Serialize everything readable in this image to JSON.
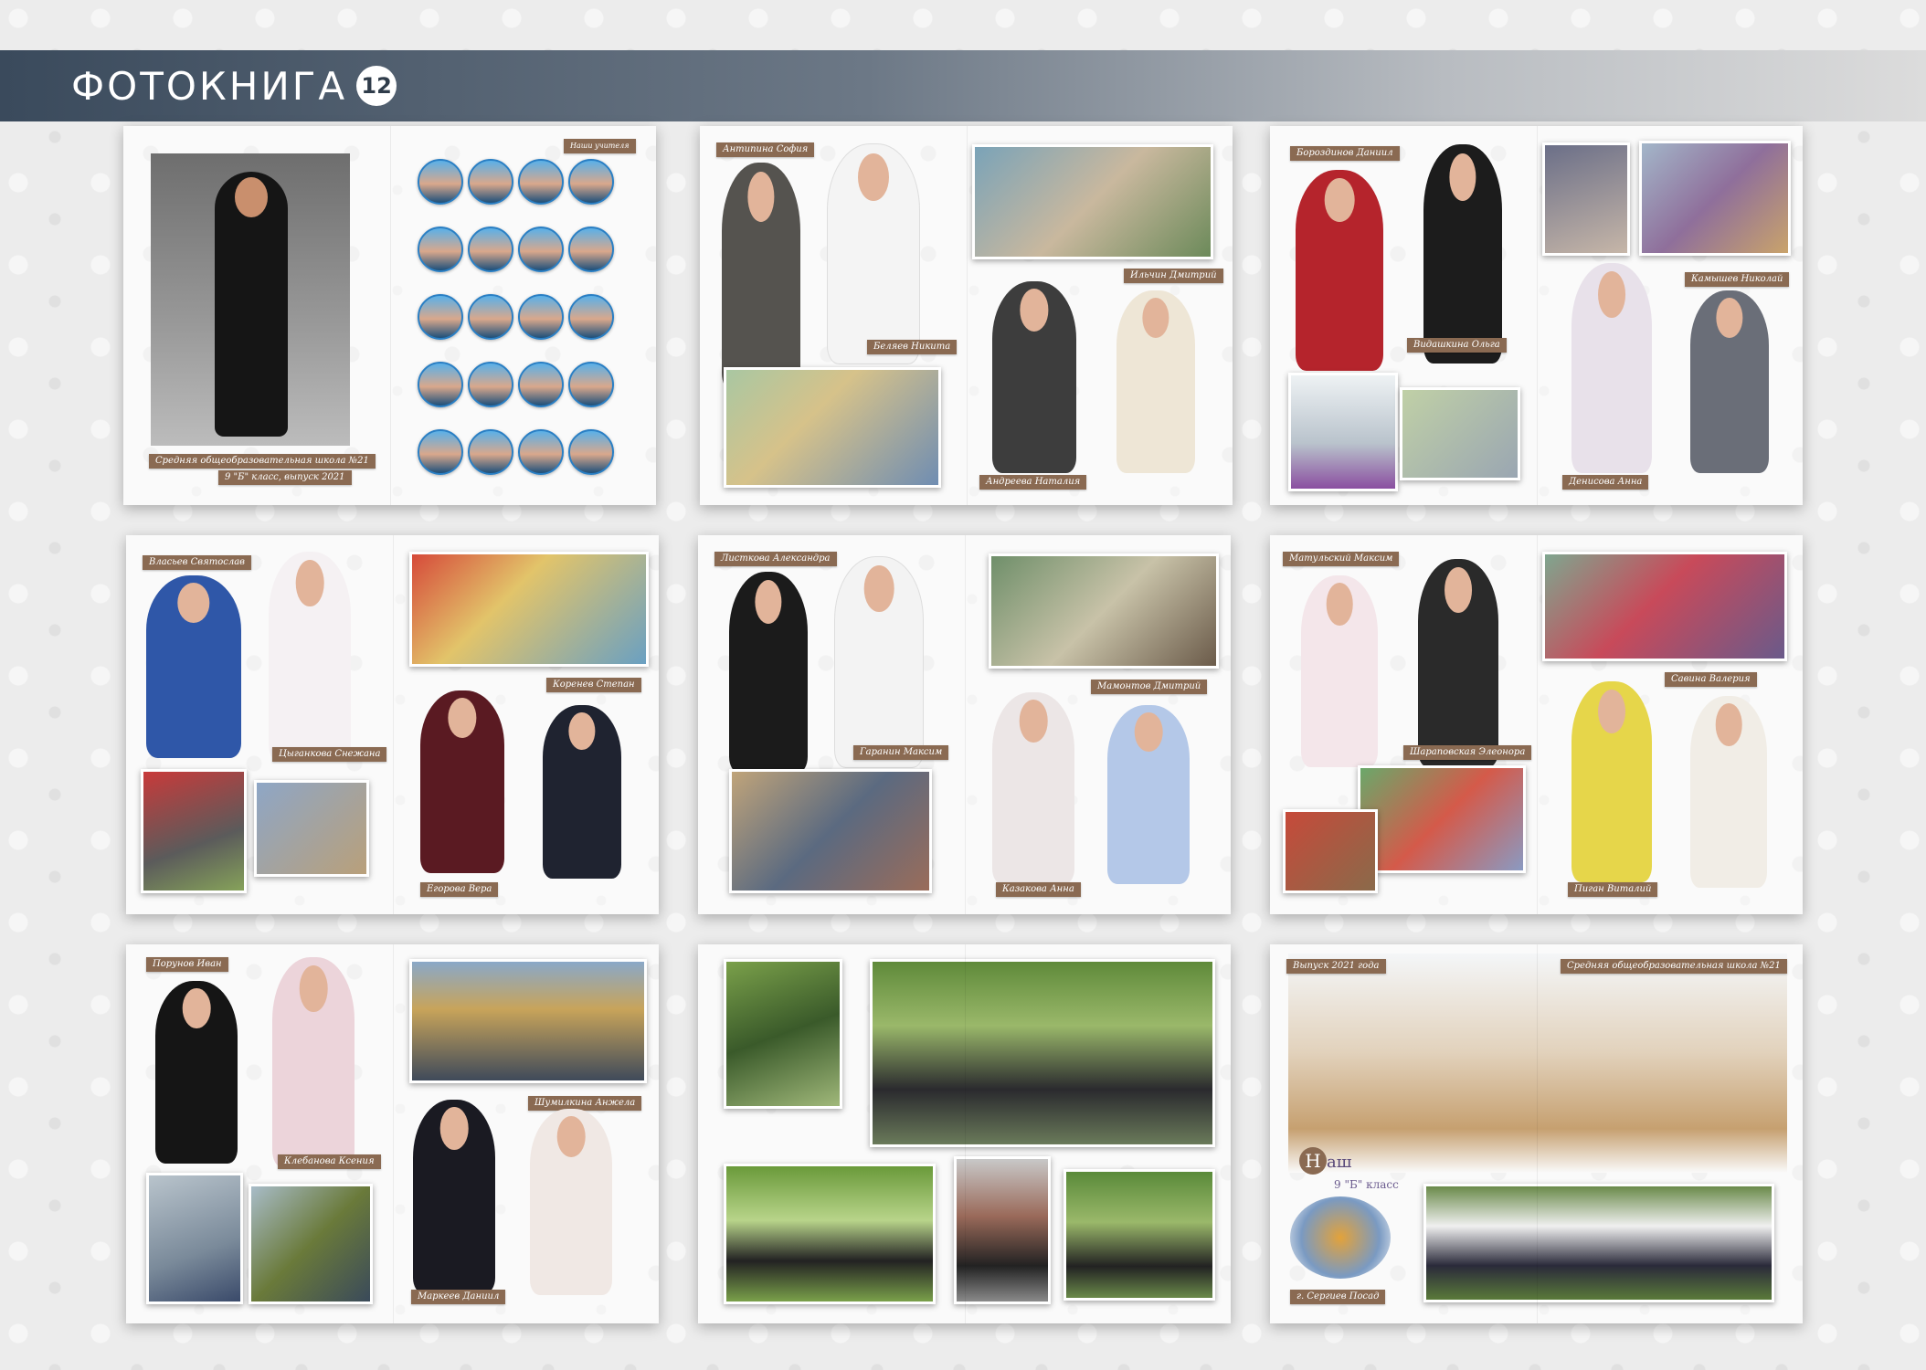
{
  "header": {
    "title": "ФОТОКНИГА",
    "badge": "12"
  },
  "spreads": [
    {
      "labels": {
        "teachers": "Наши учителя",
        "school": "Средняя общеобразовательная школа №21",
        "class": "9 \"Б\" класс, выпуск 2021"
      }
    },
    {
      "labels": [
        "Антипина София",
        "Беляев Никита",
        "Ильчин Дмитрий",
        "Андреева Наталия"
      ]
    },
    {
      "labels": [
        "Бороздинов Даниил",
        "Видашкина Ольга",
        "Камышев Николай",
        "Денисова Анна"
      ]
    },
    {
      "labels": [
        "Власьев Святослав",
        "Коренев Степан",
        "Цыганкова Снежана",
        "Егорова Вера"
      ]
    },
    {
      "labels": [
        "Листкова Александра",
        "Мамонтов Дмитрий",
        "Гаранин Максим",
        "Казакова Анна"
      ]
    },
    {
      "labels": [
        "Матульский Максим",
        "Савина Валерия",
        "Шараповская Элеонора",
        "Пиган Виталий"
      ]
    },
    {
      "labels": [
        "Порунов Иван",
        "Шумилкина Анжела",
        "Клебанова Ксения",
        "Маркеев Даниил"
      ]
    },
    {
      "labels": []
    },
    {
      "labels": {
        "year": "Выпуск 2021 года",
        "school": "Средняя общеобразовательная школа №21",
        "our_letter": "Н",
        "our_rest": "аш",
        "class": "9 \"Б\" класс",
        "city": "г. Сергиев Посад"
      }
    }
  ],
  "colors": {
    "label_bg": "#8a6a52",
    "header_dark": "#3a4a5c",
    "accent_purple": "#6b5b8e"
  }
}
